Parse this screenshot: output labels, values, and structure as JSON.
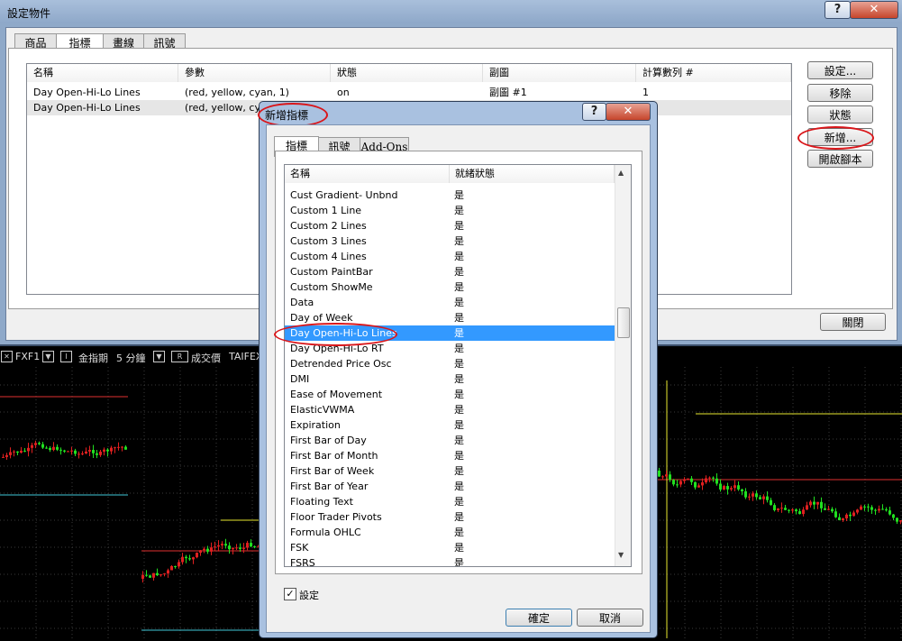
{
  "main_dialog": {
    "title": "設定物件",
    "help_label": "?",
    "close_label": "✕",
    "tabs": [
      "商品",
      "指標",
      "畫線",
      "訊號"
    ],
    "table": {
      "headers": [
        "名稱",
        "參數",
        "狀態",
        "副圖",
        "計算數列 #"
      ],
      "rows": [
        [
          "Day Open-Hi-Lo Lines",
          "(red, yellow, cyan, 1)",
          "on",
          "副圖 #1",
          "1"
        ],
        [
          "Day Open-Hi-Lo Lines",
          "(red, yellow, cya",
          "",
          "",
          ""
        ]
      ]
    },
    "buttons": {
      "settings": "設定...",
      "remove": "移除",
      "status": "狀態",
      "add": "新增...",
      "open_script": "開啟腳本",
      "close": "關閉"
    }
  },
  "chart_toolbar": {
    "symbol": "FXF1",
    "name": "金指期",
    "interval": "5 分鐘",
    "field": "成交價",
    "exchange": "TAIFEX",
    "box_i": "I",
    "box_r": "R"
  },
  "add_dialog": {
    "title": "新增指標",
    "help_label": "?",
    "close_label": "✕",
    "tabs": [
      "指標",
      "訊號",
      "Add-Ons"
    ],
    "list_headers": [
      "名稱",
      "就緒狀態"
    ],
    "items": [
      {
        "name": "Cust Gradient- Unbnd",
        "status": "是"
      },
      {
        "name": "Custom 1 Line",
        "status": "是"
      },
      {
        "name": "Custom 2 Lines",
        "status": "是"
      },
      {
        "name": "Custom 3 Lines",
        "status": "是"
      },
      {
        "name": "Custom 4 Lines",
        "status": "是"
      },
      {
        "name": "Custom PaintBar",
        "status": "是"
      },
      {
        "name": "Custom ShowMe",
        "status": "是"
      },
      {
        "name": "Data",
        "status": "是"
      },
      {
        "name": "Day of Week",
        "status": "是"
      },
      {
        "name": "Day Open-Hi-Lo Lines",
        "status": "是",
        "selected": true
      },
      {
        "name": "Day Open-Hi-Lo RT",
        "status": "是"
      },
      {
        "name": "Detrended Price Osc",
        "status": "是"
      },
      {
        "name": "DMI",
        "status": "是"
      },
      {
        "name": "Ease of Movement",
        "status": "是"
      },
      {
        "name": "ElasticVWMA",
        "status": "是"
      },
      {
        "name": "Expiration",
        "status": "是"
      },
      {
        "name": "First Bar of Day",
        "status": "是"
      },
      {
        "name": "First Bar of Month",
        "status": "是"
      },
      {
        "name": "First Bar of Week",
        "status": "是"
      },
      {
        "name": "First Bar of Year",
        "status": "是"
      },
      {
        "name": "Floating Text",
        "status": "是"
      },
      {
        "name": "Floor Trader Pivots",
        "status": "是"
      },
      {
        "name": "Formula OHLC",
        "status": "是"
      },
      {
        "name": "FSK",
        "status": "是"
      },
      {
        "name": "FSRS",
        "status": "是"
      }
    ],
    "checkbox_label": "設定",
    "checkbox_checked": true,
    "ok_label": "確定",
    "cancel_label": "取消"
  }
}
